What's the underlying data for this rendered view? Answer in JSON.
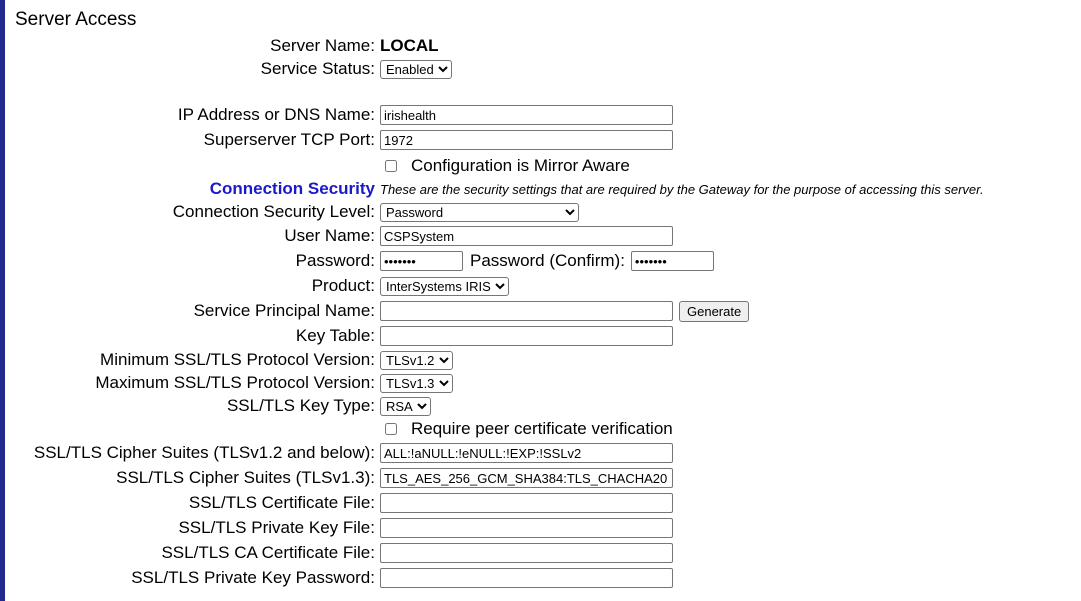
{
  "title": "Server Access",
  "server_name": {
    "label": "Server Name:",
    "value": "LOCAL"
  },
  "service_status": {
    "label": "Service Status:",
    "selected": "Enabled"
  },
  "ip_address": {
    "label": "IP Address or DNS Name:",
    "value": "irishealth"
  },
  "tcp_port": {
    "label": "Superserver TCP Port:",
    "value": "1972"
  },
  "mirror_aware": {
    "label": "Configuration is Mirror Aware",
    "checked": false
  },
  "connection_security": {
    "heading": "Connection Security",
    "note": "These are the security settings that are required by the Gateway for the purpose of accessing this server."
  },
  "security_level": {
    "label": "Connection Security Level:",
    "selected": "Password"
  },
  "user_name": {
    "label": "User Name:",
    "value": "CSPSystem"
  },
  "password": {
    "label": "Password:",
    "value": "•••••••",
    "confirm_label": "Password (Confirm):",
    "confirm_value": "•••••••"
  },
  "product": {
    "label": "Product:",
    "selected": "InterSystems IRIS"
  },
  "spn": {
    "label": "Service Principal Name:",
    "value": "",
    "button": "Generate"
  },
  "key_table": {
    "label": "Key Table:",
    "value": ""
  },
  "min_tls": {
    "label": "Minimum SSL/TLS Protocol Version:",
    "selected": "TLSv1.2"
  },
  "max_tls": {
    "label": "Maximum SSL/TLS Protocol Version:",
    "selected": "TLSv1.3"
  },
  "key_type": {
    "label": "SSL/TLS Key Type:",
    "selected": "RSA"
  },
  "peer_verify": {
    "label": "Require peer certificate verification",
    "checked": false
  },
  "cipher_12": {
    "label": "SSL/TLS Cipher Suites (TLSv1.2 and below):",
    "value": "ALL:!aNULL:!eNULL:!EXP:!SSLv2"
  },
  "cipher_13": {
    "label": "SSL/TLS Cipher Suites (TLSv1.3):",
    "value": "TLS_AES_256_GCM_SHA384:TLS_CHACHA20"
  },
  "cert_file": {
    "label": "SSL/TLS Certificate File:",
    "value": ""
  },
  "key_file": {
    "label": "SSL/TLS Private Key File:",
    "value": ""
  },
  "ca_file": {
    "label": "SSL/TLS CA Certificate File:",
    "value": ""
  },
  "key_password": {
    "label": "SSL/TLS Private Key Password:",
    "value": ""
  }
}
